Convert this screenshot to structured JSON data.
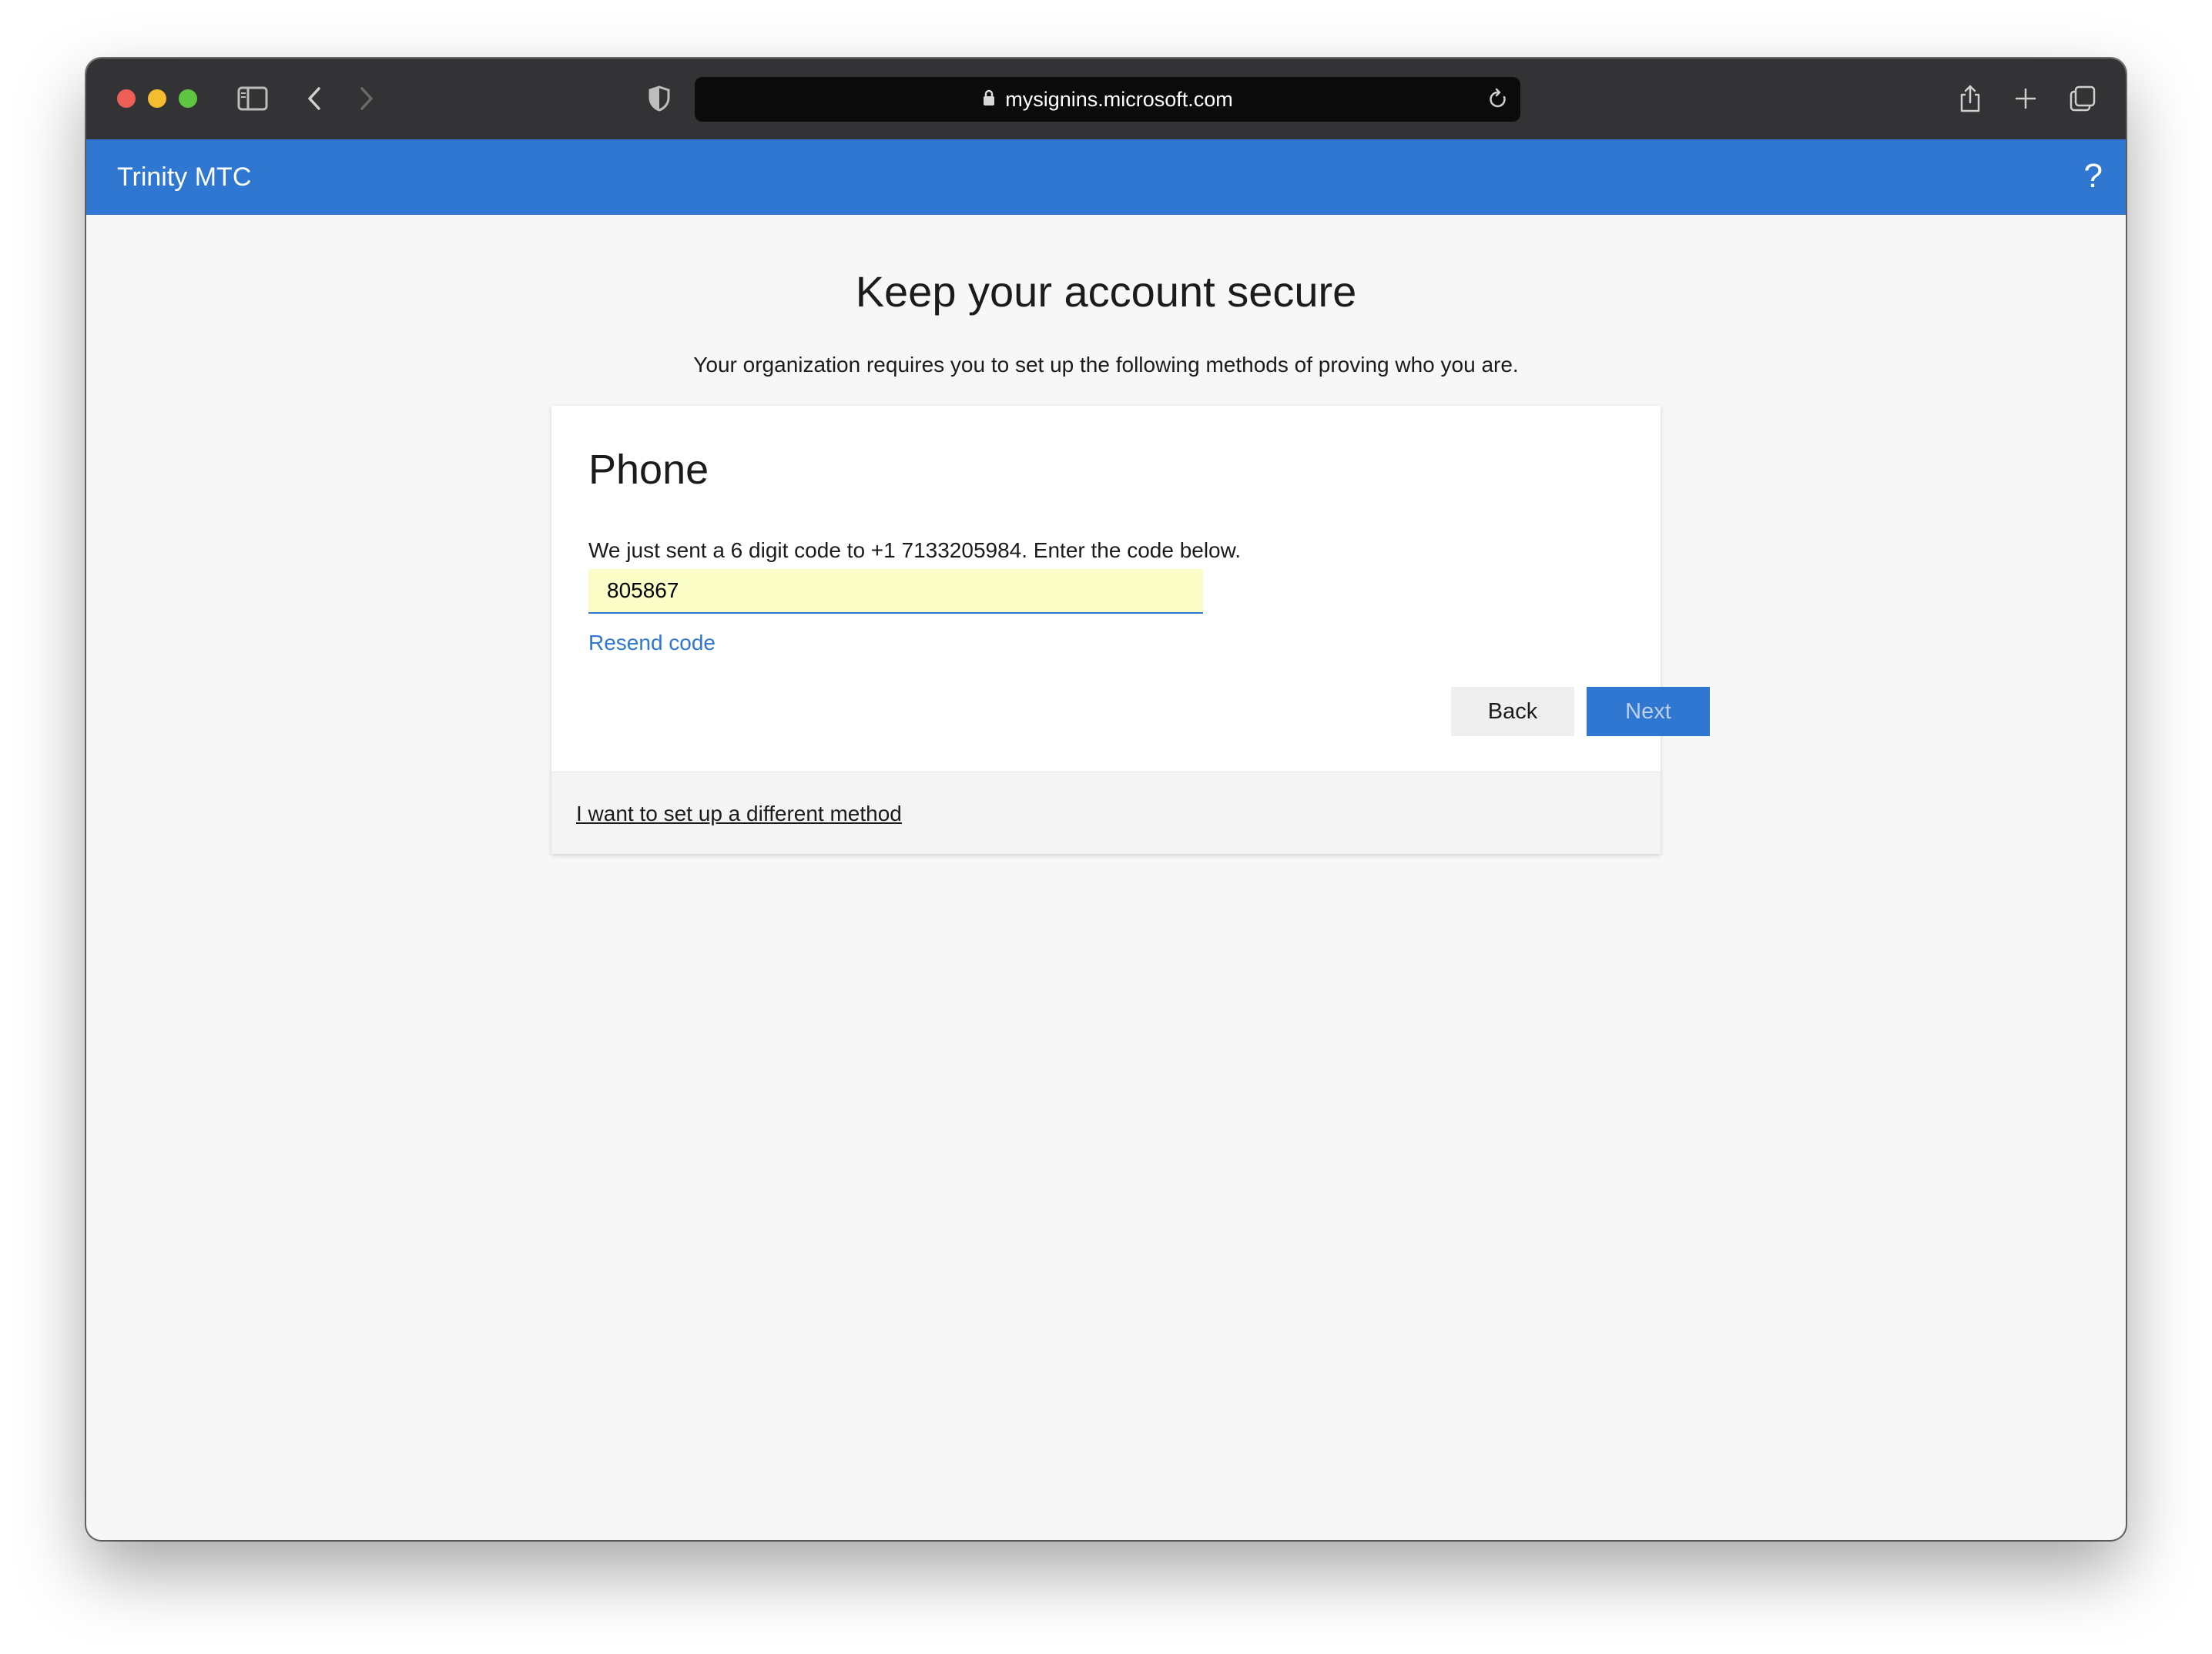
{
  "browser": {
    "url": "mysignins.microsoft.com",
    "icons": [
      "sidebar-icon",
      "back-icon",
      "forward-icon",
      "shield-icon",
      "lock-icon",
      "reload-icon",
      "share-icon",
      "plus-icon",
      "tabs-icon"
    ]
  },
  "header": {
    "org_name": "Trinity MTC",
    "help_glyph": "?"
  },
  "main": {
    "title": "Keep your account secure",
    "subtitle": "Your organization requires you to set up the following methods of proving who you are."
  },
  "card": {
    "title": "Phone",
    "message": "We just sent a 6 digit code to +1 7133205984. Enter the code below.",
    "code_value": "805867",
    "resend_label": "Resend code",
    "back_label": "Back",
    "next_label": "Next",
    "different_method_label": "I want to set up a different method"
  },
  "colors": {
    "accent": "#2f77d0",
    "input_fill": "#fbfdc6",
    "toolbar": "#333335"
  }
}
